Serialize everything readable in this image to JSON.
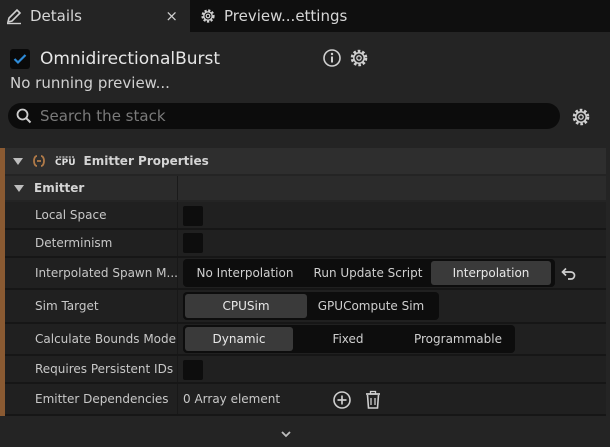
{
  "tabs": {
    "details_label": "Details",
    "details_close": "×",
    "preview_label": "Preview...ettings"
  },
  "header": {
    "emitter_name": "OmnidirectionalBurst",
    "emitter_enabled": true,
    "status_text": "No running preview..."
  },
  "search": {
    "placeholder": "Search the stack"
  },
  "section": {
    "title": "Emitter Properties",
    "cpu_badge": "CPU"
  },
  "subsection": {
    "title": "Emitter"
  },
  "properties": {
    "local_space": {
      "label": "Local Space",
      "checked": false
    },
    "determinism": {
      "label": "Determinism",
      "checked": false
    },
    "interpolated_spawn": {
      "label": "Interpolated Spawn M...",
      "options": [
        "No Interpolation",
        "Run Update Script",
        "Interpolation"
      ],
      "selected": "Interpolation"
    },
    "sim_target": {
      "label": "Sim Target",
      "options": [
        "CPUSim",
        "GPUCompute Sim"
      ],
      "selected": "CPUSim"
    },
    "bounds_mode": {
      "label": "Calculate Bounds Mode",
      "options": [
        "Dynamic",
        "Fixed",
        "Programmable"
      ],
      "selected": "Dynamic"
    },
    "persistent_ids": {
      "label": "Requires Persistent IDs",
      "checked": false
    },
    "dependencies": {
      "label": "Emitter Dependencies",
      "value": "0 Array element"
    }
  },
  "colors": {
    "accent": "#8a5a32",
    "checkbox_check": "#2e8bd8",
    "panel": "#242424"
  },
  "icons": {
    "details_tab": "pencil-icon",
    "preview_tab": "gear-icon",
    "info": "info-icon",
    "settings": "gear-icon",
    "search": "search-icon",
    "section": "link-icon",
    "undo": "reset-arrow-icon",
    "add": "add-circle-icon",
    "delete": "trash-icon",
    "footer": "chevron-down-icon"
  }
}
